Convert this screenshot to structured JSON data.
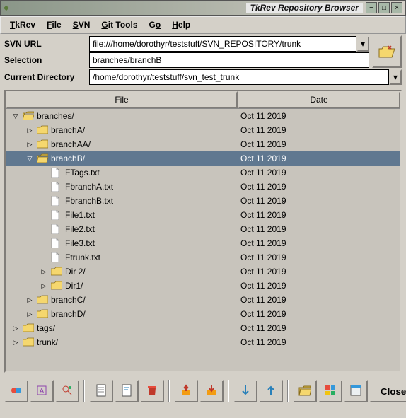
{
  "window": {
    "title": "TkRev Repository Browser"
  },
  "menu": {
    "tkrev": "TkRev",
    "file": "File",
    "svn": "SVN",
    "git": "Git Tools",
    "go": "Go",
    "help": "Help"
  },
  "form": {
    "url_label": "SVN URL",
    "url_value": "file:///home/dorothyr/teststuff/SVN_REPOSITORY/trunk",
    "sel_label": "Selection",
    "sel_value": "branches/branchB",
    "cwd_label": "Current Directory",
    "cwd_value": "/home/dorothyr/teststuff/svn_test_trunk"
  },
  "columns": {
    "file": "File",
    "date": "Date"
  },
  "rows": [
    {
      "indent": 0,
      "tw": "▽",
      "type": "folder",
      "name": "branches/",
      "date": "Oct 11 2019",
      "sel": false
    },
    {
      "indent": 1,
      "tw": "▷",
      "type": "folder",
      "name": "branchA/",
      "date": "Oct 11 2019",
      "sel": false
    },
    {
      "indent": 1,
      "tw": "▷",
      "type": "folder",
      "name": "branchAA/",
      "date": "Oct 11 2019",
      "sel": false
    },
    {
      "indent": 1,
      "tw": "▽",
      "type": "folder",
      "name": "branchB/",
      "date": "Oct 11 2019",
      "sel": true
    },
    {
      "indent": 2,
      "tw": "",
      "type": "doc",
      "name": "FTags.txt",
      "date": "Oct 11 2019",
      "sel": false
    },
    {
      "indent": 2,
      "tw": "",
      "type": "doc",
      "name": "FbranchA.txt",
      "date": "Oct 11 2019",
      "sel": false
    },
    {
      "indent": 2,
      "tw": "",
      "type": "doc",
      "name": "FbranchB.txt",
      "date": "Oct 11 2019",
      "sel": false
    },
    {
      "indent": 2,
      "tw": "",
      "type": "doc",
      "name": "File1.txt",
      "date": "Oct 11 2019",
      "sel": false
    },
    {
      "indent": 2,
      "tw": "",
      "type": "doc",
      "name": "File2.txt",
      "date": "Oct 11 2019",
      "sel": false
    },
    {
      "indent": 2,
      "tw": "",
      "type": "doc",
      "name": "File3.txt",
      "date": "Oct 11 2019",
      "sel": false
    },
    {
      "indent": 2,
      "tw": "",
      "type": "doc",
      "name": "Ftrunk.txt",
      "date": "Oct 11 2019",
      "sel": false
    },
    {
      "indent": 2,
      "tw": "▷",
      "type": "folder",
      "name": "Dir 2/",
      "date": "Oct 11 2019",
      "sel": false
    },
    {
      "indent": 2,
      "tw": "▷",
      "type": "folder",
      "name": "Dir1/",
      "date": "Oct 11 2019",
      "sel": false
    },
    {
      "indent": 1,
      "tw": "▷",
      "type": "folder",
      "name": "branchC/",
      "date": "Oct 11 2019",
      "sel": false
    },
    {
      "indent": 1,
      "tw": "▷",
      "type": "folder",
      "name": "branchD/",
      "date": "Oct 11 2019",
      "sel": false
    },
    {
      "indent": 0,
      "tw": "▷",
      "type": "folder",
      "name": "tags/",
      "date": "Oct 11 2019",
      "sel": false
    },
    {
      "indent": 0,
      "tw": "▷",
      "type": "folder",
      "name": "trunk/",
      "date": "Oct 11 2019",
      "sel": false
    }
  ],
  "toolbar": {
    "buttons": [
      "diff-tool",
      "annotate",
      "search-tree",
      "file-view",
      "file-log",
      "delete-file",
      "export",
      "import",
      "arrow-down",
      "arrow-up",
      "folder-open",
      "pattern",
      "app"
    ],
    "close": "Close"
  }
}
